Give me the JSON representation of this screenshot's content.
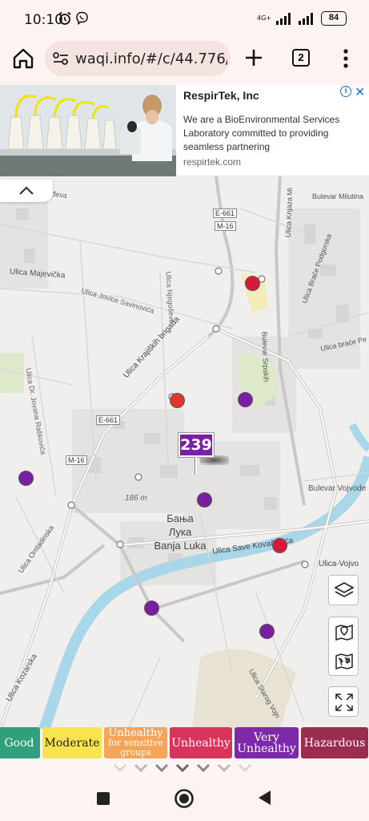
{
  "status": {
    "time": "10:10",
    "network": "4G+",
    "battery": "84"
  },
  "browser": {
    "url": "waqi.info/#/c/44.776/",
    "tab_count": "2"
  },
  "ad": {
    "title": "RespirTek, Inc",
    "description": "We are a BioEnvironmental Services Laboratory committed to providing seamless partnering",
    "domain": "respirtek.com"
  },
  "map": {
    "city_cyrillic_1": "Бања",
    "city_cyrillic_2": "Лука",
    "city_latin": "Banja Luka",
    "selected_aqi": "239",
    "scale_label": "186 m",
    "streets": {
      "karadjordjeva": "Ulica Karađorđeva",
      "majevicka": "Ulica Majevička",
      "savinovica": "Ulica Jovice Savinovića",
      "njegoseva": "Ulica Njegoševa",
      "kralj_brigada": "Ulica Krajiških brigada",
      "jovan_raskovic": "Ulica Dr. Jovana Raškovića",
      "omladinska": "Ulica Omladinska",
      "kozarska": "Ulica Kozarska",
      "sprskih": "Bulevar Srpskih",
      "knjaza": "Ulica Knjaza Mi",
      "milutina": "Bulevar Milutina",
      "podgorska": "Ulica Braće Podgorska",
      "brace_pe": "Ulica braće Pe",
      "vojvode": "Bulevar Vojvode",
      "save_kovacevica": "Ulica Save Kovačevića",
      "ulica_vojvo": "Ulica-Vojvo",
      "starog_vojn": "Ulica Starog Vojn",
      "e661_a": "E-661",
      "m16_a": "M-16",
      "e661_b": "E-661",
      "m16_b": "M-16"
    },
    "markers": [
      {
        "color": "#d8193b",
        "level": "Unhealthy"
      },
      {
        "color": "#e2372e",
        "level": "Unhealthy"
      },
      {
        "color": "#7a1fa2",
        "level": "Very Unhealthy"
      },
      {
        "color": "#7a1fa2",
        "level": "Very Unhealthy"
      },
      {
        "color": "#7a1fa2",
        "level": "Very Unhealthy"
      },
      {
        "color": "#d8193b",
        "level": "Unhealthy"
      },
      {
        "color": "#7a1fa2",
        "level": "Very Unhealthy"
      },
      {
        "color": "#7a1fa2",
        "level": "Very Unhealthy"
      }
    ]
  },
  "legend": [
    {
      "label": "Good",
      "color": "#2f9f7c"
    },
    {
      "label": "Moderate",
      "color": "#f7e44f"
    },
    {
      "label": "Unhealthy",
      "sub1": "for sensitive",
      "sub2": "groups",
      "color": "#f5a45a"
    },
    {
      "label": "Unhealthy",
      "color": "#d9345b"
    },
    {
      "label": "Very",
      "label2": "Unhealthy",
      "color": "#7d2aaa"
    },
    {
      "label": "Hazardous",
      "color": "#9b2e4e"
    }
  ]
}
